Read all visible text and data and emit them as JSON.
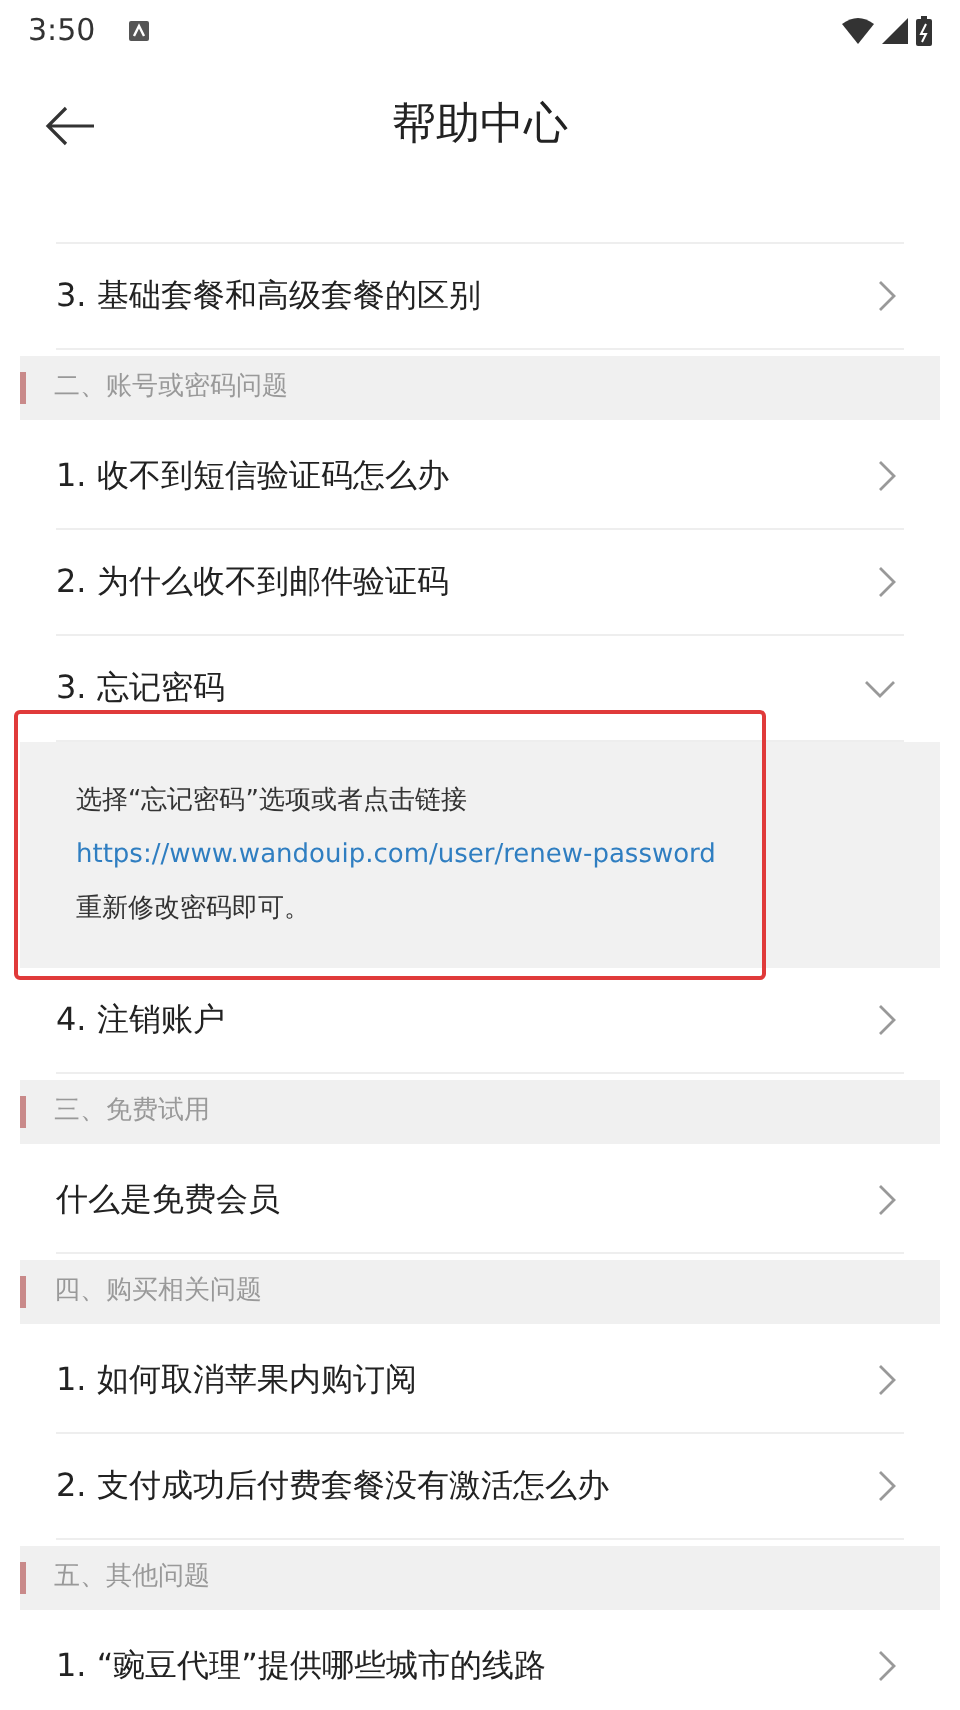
{
  "status_bar": {
    "time": "3:50"
  },
  "header": {
    "title": "帮助中心"
  },
  "groups": [
    {
      "items": [
        {
          "label": "3. 基础套餐和高级套餐的区别",
          "expanded": false
        }
      ]
    },
    {
      "title": "二、账号或密码问题",
      "items": [
        {
          "label": "1. 收不到短信验证码怎么办",
          "expanded": false
        },
        {
          "label": "2. 为什么收不到邮件验证码",
          "expanded": false
        },
        {
          "label": "3. 忘记密码",
          "expanded": true,
          "answer": {
            "highlighted": true,
            "lines": [
              {
                "kind": "text",
                "text": "选择“忘记密码”选项或者点击链接"
              },
              {
                "kind": "link",
                "text": "https://www.wandouip.com/user/renew-password"
              },
              {
                "kind": "text",
                "text": "重新修改密码即可。"
              }
            ]
          }
        },
        {
          "label": "4. 注销账户",
          "expanded": false
        }
      ]
    },
    {
      "title": "三、免费试用",
      "items": [
        {
          "label": "什么是免费会员",
          "expanded": false
        }
      ]
    },
    {
      "title": "四、购买相关问题",
      "items": [
        {
          "label": "1. 如何取消苹果内购订阅",
          "expanded": false
        },
        {
          "label": "2. 支付成功后付费套餐没有激活怎么办",
          "expanded": false
        }
      ]
    },
    {
      "title": "五、其他问题",
      "items": [
        {
          "label": "1. “豌豆代理”提供哪些城市的线路",
          "expanded": false
        }
      ]
    }
  ]
}
